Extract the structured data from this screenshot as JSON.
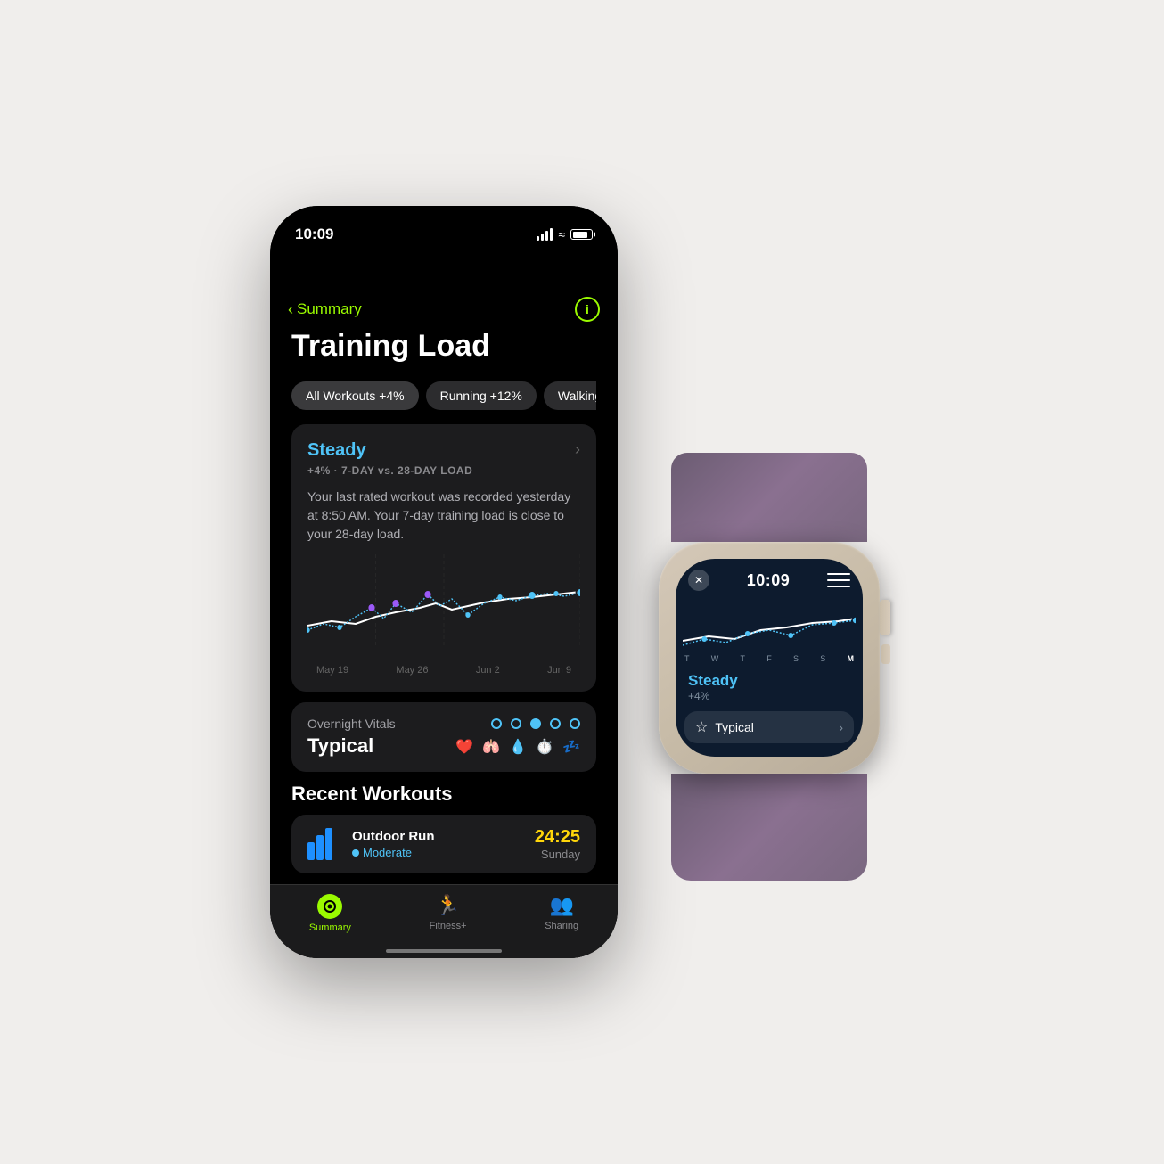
{
  "phone": {
    "status": {
      "time": "10:09"
    },
    "nav": {
      "back_label": "Summary",
      "info_label": "i"
    },
    "page": {
      "title": "Training Load"
    },
    "segments": [
      {
        "label": "All Workouts +4%",
        "active": true
      },
      {
        "label": "Running +12%",
        "active": false
      },
      {
        "label": "Walking",
        "active": false
      }
    ],
    "training_card": {
      "status": "Steady",
      "subtitle": "+4% · 7-DAY vs. 28-DAY LOAD",
      "body": "Your last rated workout was recorded yesterday at 8:50 AM. Your 7-day training load is close to your 28-day load.",
      "dates": [
        "May 19",
        "May 26",
        "Jun 2",
        "Jun 9"
      ]
    },
    "vitals": {
      "label": "Overnight Vitals",
      "value": "Typical"
    },
    "recent_workouts": {
      "section_title": "Recent Workouts",
      "items": [
        {
          "name": "Outdoor Run",
          "intensity": "Moderate",
          "duration": "24:25",
          "day": "Sunday"
        }
      ]
    },
    "tab_bar": {
      "tabs": [
        {
          "label": "Summary",
          "active": true
        },
        {
          "label": "Fitness+",
          "active": false
        },
        {
          "label": "Sharing",
          "active": false
        }
      ]
    }
  },
  "watch": {
    "status": {
      "time": "10:09"
    },
    "days": [
      "T",
      "W",
      "T",
      "F",
      "S",
      "S",
      "M"
    ],
    "steady": {
      "title": "Steady",
      "subtitle": "+4%"
    },
    "typical": {
      "label": "Typical"
    }
  },
  "colors": {
    "accent_green": "#9afa00",
    "accent_blue": "#4fc3f7",
    "accent_yellow": "#ffd60a",
    "bg_dark": "#000000",
    "bg_card": "#1c1c1e",
    "text_primary": "#ffffff",
    "text_secondary": "#8a8a8e",
    "chart_blue": "#3a7bd5",
    "chart_white": "#ffffff",
    "chart_purple": "#bf5af2"
  }
}
